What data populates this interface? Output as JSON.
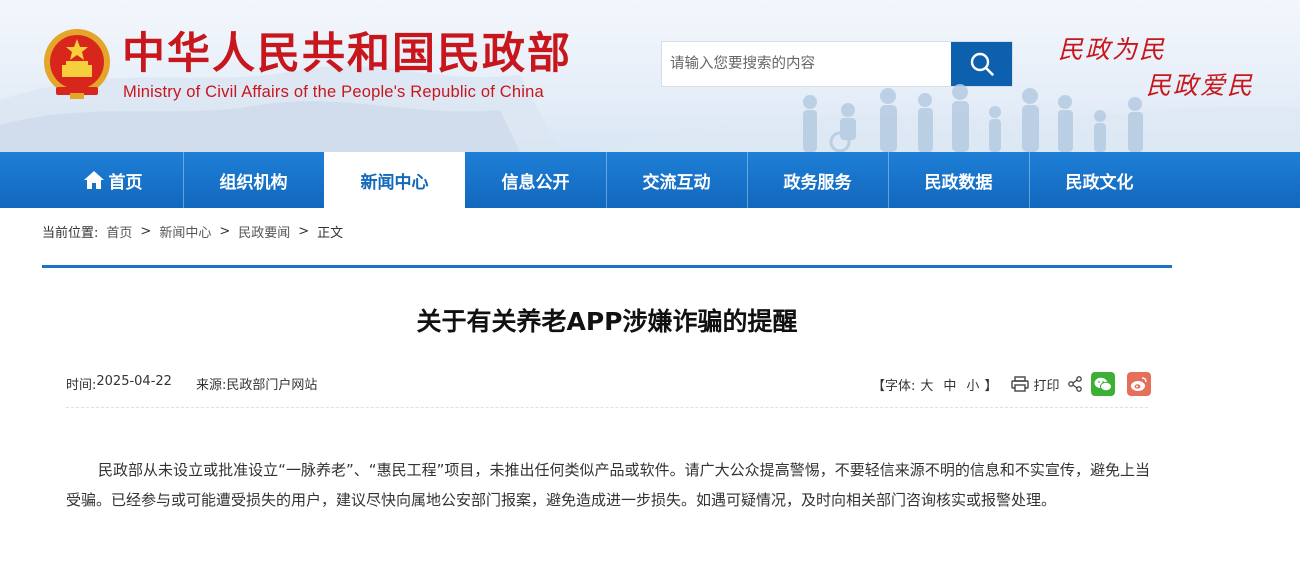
{
  "header": {
    "site_title": "中华人民共和国民政部",
    "site_subtitle": "Ministry of Civil Affairs of the People's Republic of China",
    "emblem_icon": "national-emblem-icon",
    "search": {
      "placeholder": "请输入您要搜索的内容",
      "value": "",
      "button_icon": "search-icon"
    },
    "slogan_line1": "民政为民",
    "slogan_line2": "民政爱民",
    "brand_color": "#c8161d"
  },
  "nav": {
    "accent_color": "#1268bd",
    "active_index": 2,
    "items": [
      {
        "label": "首页",
        "icon": "home-icon"
      },
      {
        "label": "组织机构"
      },
      {
        "label": "新闻中心"
      },
      {
        "label": "信息公开"
      },
      {
        "label": "交流互动"
      },
      {
        "label": "政务服务"
      },
      {
        "label": "民政数据"
      },
      {
        "label": "民政文化"
      }
    ]
  },
  "breadcrumb": {
    "label": "当前位置:",
    "items": [
      "首页",
      "新闻中心",
      "民政要闻"
    ],
    "separator": ">",
    "current": "正文"
  },
  "article": {
    "title": "关于有关养老APP涉嫌诈骗的提醒",
    "date_label": "时间:",
    "date": "2025-04-22",
    "source_label": "来源:",
    "source": "民政部门户网站",
    "font_size_label": "【字体:",
    "font_sizes": [
      "大",
      "中",
      "小"
    ],
    "font_size_close": "】",
    "print_label": "打印",
    "share_icons": [
      "share-icon",
      "wechat-icon",
      "weibo-icon"
    ],
    "body": "民政部从未设立或批准设立“一脉养老”、“惠民工程”项目，未推出任何类似产品或软件。请广大公众提高警惕，不要轻信来源不明的信息和不实宣传，避免上当受骗。已经参与或可能遭受损失的用户，建议尽快向属地公安部门报案，避免造成进一步损失。如遇可疑情况，及时向相关部门咨询核实或报警处理。"
  }
}
